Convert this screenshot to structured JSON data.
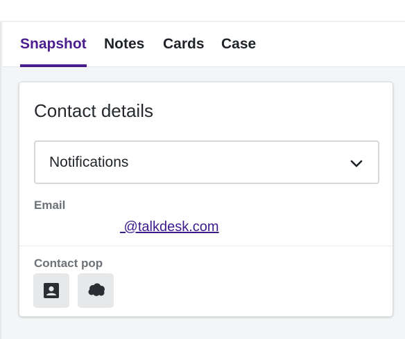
{
  "tabs": [
    {
      "label": "Snapshot",
      "active": true
    },
    {
      "label": "Notes",
      "active": false
    },
    {
      "label": "Cards",
      "active": false
    },
    {
      "label": "Case",
      "active": false
    }
  ],
  "card": {
    "title": "Contact details",
    "dropdown": {
      "value": "Notifications",
      "icon": "chevron-down-icon"
    },
    "email": {
      "label": "Email",
      "value": " @talkdesk.com"
    },
    "contact_pop": {
      "label": "Contact pop",
      "buttons": [
        {
          "icon": "contact-card-icon"
        },
        {
          "icon": "salesforce-cloud-icon"
        }
      ]
    }
  },
  "colors": {
    "accent": "#4a1d8f",
    "link": "#3c1a8c",
    "panel_bg": "#f4f5f6",
    "button_bg": "#e6e8ea"
  }
}
